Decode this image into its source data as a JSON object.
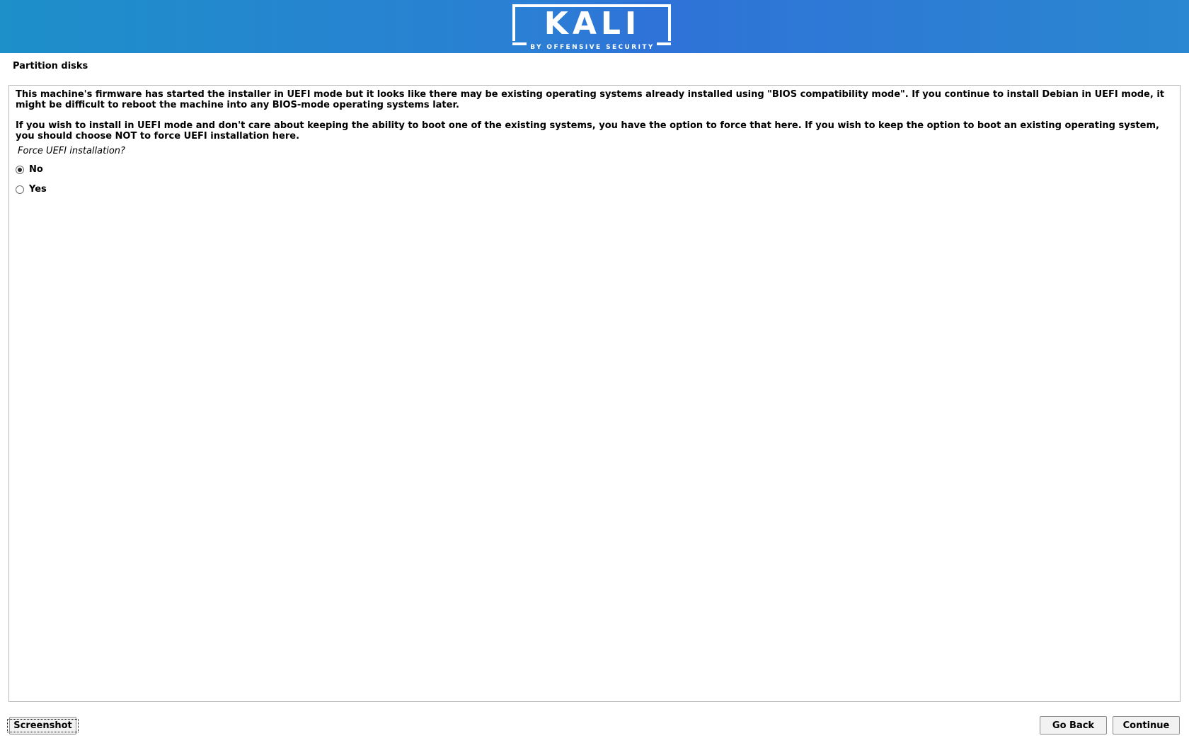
{
  "banner": {
    "logo_word": "KALI",
    "logo_tagline": "BY OFFENSIVE SECURITY"
  },
  "step_title": "Partition disks",
  "message": {
    "paragraph_1": "This machine's firmware has started the installer in UEFI mode but it looks like there may be existing operating systems already installed using \"BIOS compatibility mode\". If you continue to install Debian in UEFI mode, it might be difficult to reboot the machine into any BIOS-mode operating systems later.",
    "paragraph_2": "If you wish to install in UEFI mode and don't care about keeping the ability to boot one of the existing systems, you have the option to force that here. If you wish to keep the option to boot an existing operating system, you should choose NOT to force UEFI installation here."
  },
  "question": "Force UEFI installation?",
  "options": [
    {
      "label": "No",
      "selected": true
    },
    {
      "label": "Yes",
      "selected": false
    }
  ],
  "buttons": {
    "screenshot": "Screenshot",
    "go_back": "Go Back",
    "continue": "Continue"
  },
  "colors": {
    "banner_left": "#1d8fc9",
    "banner_center": "#2f72d8",
    "panel_border": "#b9b9b9"
  }
}
